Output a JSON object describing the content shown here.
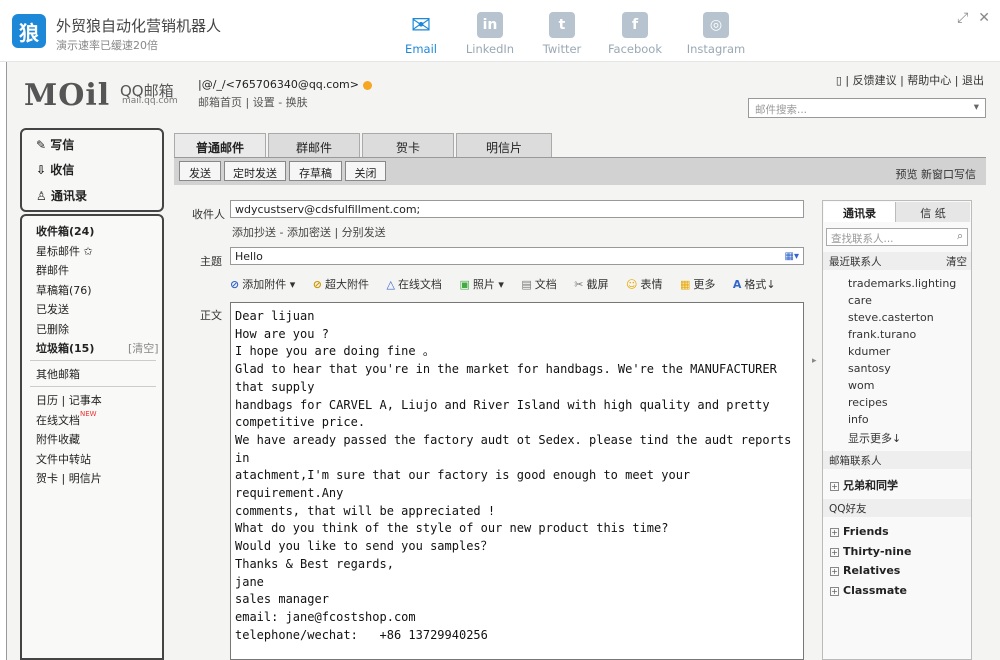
{
  "app": {
    "logo_char": "狼",
    "title": "外贸狼自动化营销机器人",
    "subtitle": "演示速率已缓速20倍"
  },
  "share": [
    {
      "label": "Email",
      "icon": "email-icon",
      "glyph": "✉"
    },
    {
      "label": "LinkedIn",
      "icon": "linkedin-icon",
      "glyph": "in"
    },
    {
      "label": "Twitter",
      "icon": "twitter-icon",
      "glyph": "t"
    },
    {
      "label": "Facebook",
      "icon": "facebook-icon",
      "glyph": "f"
    },
    {
      "label": "Instagram",
      "icon": "instagram-icon",
      "glyph": "◎"
    }
  ],
  "window": {
    "expand": "⤢",
    "close": "✕"
  },
  "mail": {
    "logo": "MOil",
    "logo_cn": "QQ邮箱",
    "logo_url": "mail.qq.com",
    "account": "|@/_/<765706340@qq.com>",
    "account_links": "邮箱首页 | 设置 - 换肤",
    "top_links": "▯ | 反馈建议 | 帮助中心 | 退出",
    "search_placeholder": "邮件搜索..."
  },
  "nav": {
    "write": "写信",
    "receive": "收信",
    "contacts": "通讯录"
  },
  "folders": [
    {
      "label": "收件箱(24)",
      "bold": true
    },
    {
      "label": "星标邮件 ✩",
      "bold": false
    },
    {
      "label": "群邮件",
      "bold": false
    },
    {
      "label": "草稿箱(76)",
      "bold": false
    },
    {
      "label": "已发送",
      "bold": false
    },
    {
      "label": "已删除",
      "bold": false
    },
    {
      "label": "垃圾箱(15)",
      "bold": true
    },
    {
      "label": "其他邮箱",
      "bold": false
    },
    {
      "label": "日历 | 记事本",
      "bold": false
    },
    {
      "label": "在线文档",
      "bold": false
    },
    {
      "label": "附件收藏",
      "bold": false
    },
    {
      "label": "文件中转站",
      "bold": false
    },
    {
      "label": "贺卡 | 明信片",
      "bold": false
    }
  ],
  "clear_label": "[清空]",
  "new_tag": "NEW",
  "tabs": [
    "普通邮件",
    "群邮件",
    "贺卡",
    "明信片"
  ],
  "actions": [
    "发送",
    "定时发送",
    "存草稿",
    "关闭"
  ],
  "toolbar_right": "预览  新窗口写信",
  "compose": {
    "to_label": "收件人",
    "to_value": "wdycustserv@cdsfulfillment.com;",
    "to_links": "添加抄送 - 添加密送 | 分别发送",
    "subject_label": "主题",
    "subject_value": "Hello",
    "body_label": "正文",
    "rich_tools": [
      {
        "icon": "paperclip-icon",
        "glyph": "⊘",
        "label": "添加附件 ▾"
      },
      {
        "icon": "big-attachment-icon",
        "glyph": "⊘",
        "label": "超大附件"
      },
      {
        "icon": "online-doc-icon",
        "glyph": "△",
        "label": "在线文档"
      },
      {
        "icon": "photo-icon",
        "glyph": "▣",
        "label": "照片 ▾"
      },
      {
        "icon": "doc-icon",
        "glyph": "▤",
        "label": "文档"
      },
      {
        "icon": "screenshot-icon",
        "glyph": "✂",
        "label": "截屏"
      },
      {
        "icon": "emoji-icon",
        "glyph": "☺",
        "label": "表情"
      },
      {
        "icon": "more-icon",
        "glyph": "▦",
        "label": "更多"
      },
      {
        "icon": "format-icon",
        "glyph": "A",
        "label": "格式↓"
      }
    ],
    "body": "Dear lijuan\nHow are you ?\nI hope you are doing fine 。\nGlad to hear that you're in the market for handbags. We're the MANUFACTURER that supply\nhandbags for CARVEL A, Liujo and River Island with high quality and pretty competitive price.\nWe have aready passed the factory audt ot Sedex. please tind the audt reports in\natachment,I'm sure that our factory is good enough to meet your requirement.Any\ncomments, that will be appreciated !\nWhat do you think of the style of our new product this time?\nWould you like to send you samples？\nThanks & Best regards,\njane\nsales manager\nemail: jane@fcostshop.com\ntelephone/wechat:   +86 13729940256"
  },
  "contacts": {
    "tab1": "通讯录",
    "tab2": "信 纸",
    "search_placeholder": "查找联系人...",
    "recent_label": "最近联系人",
    "recent_clear": "清空",
    "recent": [
      "trademarks.lighting",
      "care",
      "steve.casterton",
      "frank.turano",
      "kdumer",
      "santosy",
      "wom",
      "recipes",
      "info",
      "显示更多↓"
    ],
    "mail_contacts_label": "邮箱联系人",
    "mail_groups": [
      "兄弟和同学"
    ],
    "qq_label": "QQ好友",
    "qq_groups": [
      "Friends",
      "Thirty-nine",
      "Relatives",
      "Classmate"
    ]
  }
}
